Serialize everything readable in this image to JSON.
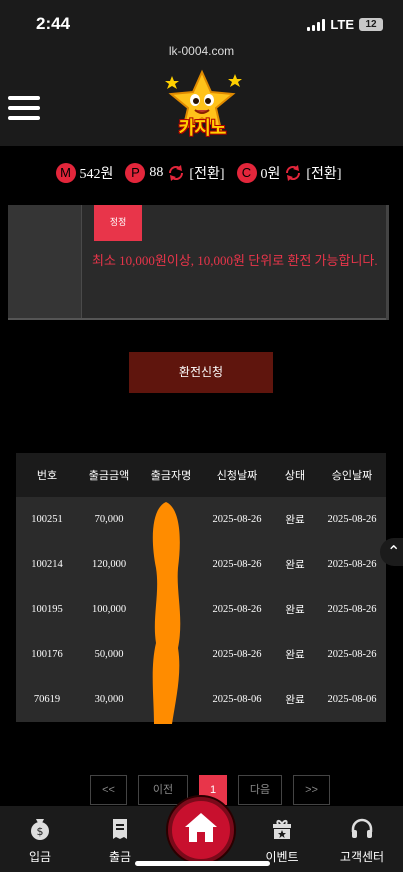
{
  "status_bar": {
    "time": "2:44",
    "network": "LTE",
    "battery": "12"
  },
  "url": "lk-0004.com",
  "logo": {
    "text": "카지노"
  },
  "balances": {
    "m_badge": "M",
    "m_value": "542원",
    "p_badge": "P",
    "p_value": "88",
    "p_convert": "[전환]",
    "c_badge": "C",
    "c_value": "0원",
    "c_convert": "[전환]"
  },
  "form": {
    "edit_label": "정정",
    "notice": "최소 10,000원이상, 10,000원 단위로 환전 가능합니다.",
    "submit_label": "환전신청"
  },
  "table": {
    "headers": [
      "번호",
      "출금금액",
      "출금자명",
      "신청날짜",
      "상태",
      "승인날짜"
    ],
    "rows": [
      [
        "100251",
        "70,000",
        "",
        "2025-08-26",
        "완료",
        "2025-08-26"
      ],
      [
        "100214",
        "120,000",
        "",
        "2025-08-26",
        "완료",
        "2025-08-26"
      ],
      [
        "100195",
        "100,000",
        "",
        "2025-08-26",
        "완료",
        "2025-08-26"
      ],
      [
        "100176",
        "50,000",
        "",
        "2025-08-26",
        "완료",
        "2025-08-26"
      ],
      [
        "70619",
        "30,000",
        "",
        "2025-08-06",
        "완료",
        "2025-08-06"
      ]
    ]
  },
  "pagination": {
    "first": "<<",
    "prev": "이전",
    "current": "1",
    "next": "다음",
    "last": ">>"
  },
  "bottom_nav": {
    "deposit": "입금",
    "withdraw": "출금",
    "event": "이벤트",
    "support": "고객센터"
  },
  "icons": [
    "signal-icon",
    "battery-icon",
    "hamburger-icon",
    "star-mascot-icon",
    "refresh-icon",
    "chevron-up-icon",
    "coin-bag-icon",
    "receipt-icon",
    "home-icon",
    "gift-icon",
    "headset-icon"
  ],
  "colors": {
    "accent": "#e8354a",
    "submit_bg": "#5f150d",
    "panel_bg": "#2a2a2a",
    "redaction": "#ff8c00"
  }
}
